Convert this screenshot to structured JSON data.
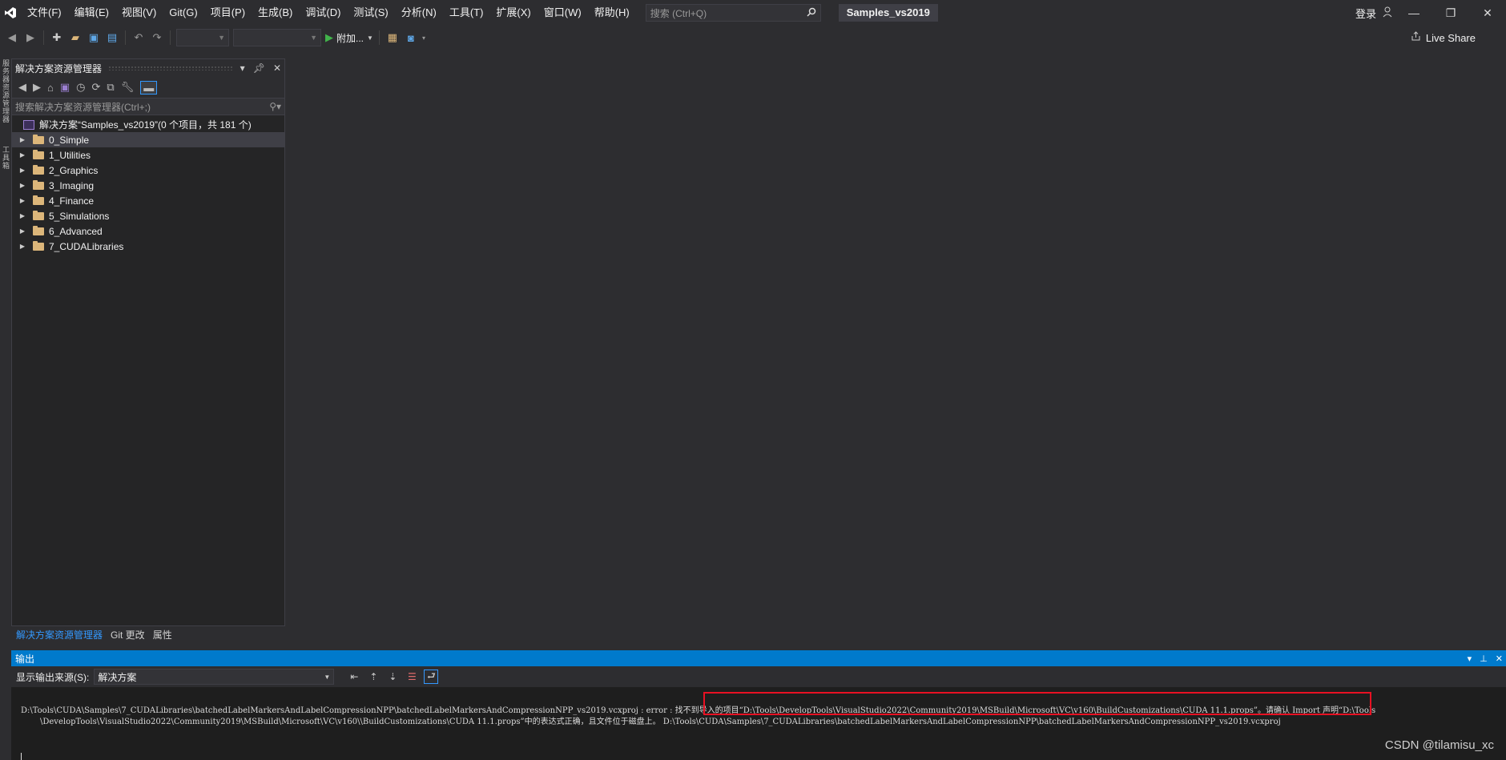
{
  "menu": {
    "items": [
      "文件(F)",
      "编辑(E)",
      "视图(V)",
      "Git(G)",
      "项目(P)",
      "生成(B)",
      "调试(D)",
      "测试(S)",
      "分析(N)",
      "工具(T)",
      "扩展(X)",
      "窗口(W)",
      "帮助(H)"
    ],
    "search_placeholder": "搜索 (Ctrl+Q)",
    "solution_title": "Samples_vs2019",
    "login_label": "登录"
  },
  "toolbar": {
    "run_label": "附加...",
    "live_share_label": "Live Share"
  },
  "left_strip": {
    "tab1": "服务器资源管理器",
    "tab2": "工具箱"
  },
  "solution_explorer": {
    "title": "解决方案资源管理器",
    "search_placeholder": "搜索解决方案资源管理器(Ctrl+;)",
    "root_label": "解决方案“Samples_vs2019”(0 个项目，共 181 个)",
    "folders": [
      "0_Simple",
      "1_Utilities",
      "2_Graphics",
      "3_Imaging",
      "4_Finance",
      "5_Simulations",
      "6_Advanced",
      "7_CUDALibraries"
    ],
    "tabs": [
      "解决方案资源管理器",
      "Git 更改",
      "属性"
    ]
  },
  "output": {
    "title": "输出",
    "source_label": "显示输出来源(S):",
    "source_value": "解决方案",
    "line1": "D:\\Tools\\CUDA\\Samples\\7_CUDALibraries\\batchedLabelMarkersAndLabelCompressionNPP\\batchedLabelMarkersAndCompressionNPP_vs2019.vcxproj : error  : 找不到导入的项目“D:\\Tools\\DevelopTools\\VisualStudio2022\\Community2019\\MSBuild\\Microsoft\\VC\\v160\\BuildCustomizations\\CUDA 11.1.props”。请确认 Import 声明“D:\\Tools",
    "line2": "\\DevelopTools\\VisualStudio2022\\Community2019\\MSBuild\\Microsoft\\VC\\v160\\\\BuildCustomizations\\CUDA 11.1.props”中的表达式正确，且文件位于磁盘上。  D:\\Tools\\CUDA\\Samples\\7_CUDALibraries\\batchedLabelMarkersAndLabelCompressionNPP\\batchedLabelMarkersAndCompressionNPP_vs2019.vcxproj"
  },
  "watermark": "CSDN @tilamisu_xc",
  "colors": {
    "accent": "#007acc",
    "highlight": "#e81123",
    "folder": "#dcb67a"
  }
}
